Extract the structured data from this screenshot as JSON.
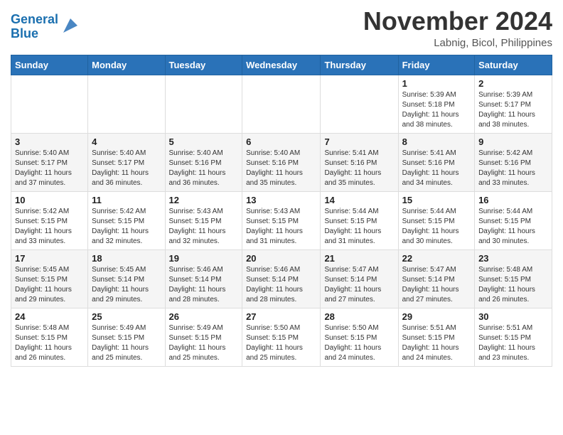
{
  "header": {
    "logo_line1": "General",
    "logo_line2": "Blue",
    "month": "November 2024",
    "location": "Labnig, Bicol, Philippines"
  },
  "weekdays": [
    "Sunday",
    "Monday",
    "Tuesday",
    "Wednesday",
    "Thursday",
    "Friday",
    "Saturday"
  ],
  "weeks": [
    [
      {
        "day": "",
        "info": ""
      },
      {
        "day": "",
        "info": ""
      },
      {
        "day": "",
        "info": ""
      },
      {
        "day": "",
        "info": ""
      },
      {
        "day": "",
        "info": ""
      },
      {
        "day": "1",
        "info": "Sunrise: 5:39 AM\nSunset: 5:18 PM\nDaylight: 11 hours\nand 38 minutes."
      },
      {
        "day": "2",
        "info": "Sunrise: 5:39 AM\nSunset: 5:17 PM\nDaylight: 11 hours\nand 38 minutes."
      }
    ],
    [
      {
        "day": "3",
        "info": "Sunrise: 5:40 AM\nSunset: 5:17 PM\nDaylight: 11 hours\nand 37 minutes."
      },
      {
        "day": "4",
        "info": "Sunrise: 5:40 AM\nSunset: 5:17 PM\nDaylight: 11 hours\nand 36 minutes."
      },
      {
        "day": "5",
        "info": "Sunrise: 5:40 AM\nSunset: 5:16 PM\nDaylight: 11 hours\nand 36 minutes."
      },
      {
        "day": "6",
        "info": "Sunrise: 5:40 AM\nSunset: 5:16 PM\nDaylight: 11 hours\nand 35 minutes."
      },
      {
        "day": "7",
        "info": "Sunrise: 5:41 AM\nSunset: 5:16 PM\nDaylight: 11 hours\nand 35 minutes."
      },
      {
        "day": "8",
        "info": "Sunrise: 5:41 AM\nSunset: 5:16 PM\nDaylight: 11 hours\nand 34 minutes."
      },
      {
        "day": "9",
        "info": "Sunrise: 5:42 AM\nSunset: 5:16 PM\nDaylight: 11 hours\nand 33 minutes."
      }
    ],
    [
      {
        "day": "10",
        "info": "Sunrise: 5:42 AM\nSunset: 5:15 PM\nDaylight: 11 hours\nand 33 minutes."
      },
      {
        "day": "11",
        "info": "Sunrise: 5:42 AM\nSunset: 5:15 PM\nDaylight: 11 hours\nand 32 minutes."
      },
      {
        "day": "12",
        "info": "Sunrise: 5:43 AM\nSunset: 5:15 PM\nDaylight: 11 hours\nand 32 minutes."
      },
      {
        "day": "13",
        "info": "Sunrise: 5:43 AM\nSunset: 5:15 PM\nDaylight: 11 hours\nand 31 minutes."
      },
      {
        "day": "14",
        "info": "Sunrise: 5:44 AM\nSunset: 5:15 PM\nDaylight: 11 hours\nand 31 minutes."
      },
      {
        "day": "15",
        "info": "Sunrise: 5:44 AM\nSunset: 5:15 PM\nDaylight: 11 hours\nand 30 minutes."
      },
      {
        "day": "16",
        "info": "Sunrise: 5:44 AM\nSunset: 5:15 PM\nDaylight: 11 hours\nand 30 minutes."
      }
    ],
    [
      {
        "day": "17",
        "info": "Sunrise: 5:45 AM\nSunset: 5:15 PM\nDaylight: 11 hours\nand 29 minutes."
      },
      {
        "day": "18",
        "info": "Sunrise: 5:45 AM\nSunset: 5:14 PM\nDaylight: 11 hours\nand 29 minutes."
      },
      {
        "day": "19",
        "info": "Sunrise: 5:46 AM\nSunset: 5:14 PM\nDaylight: 11 hours\nand 28 minutes."
      },
      {
        "day": "20",
        "info": "Sunrise: 5:46 AM\nSunset: 5:14 PM\nDaylight: 11 hours\nand 28 minutes."
      },
      {
        "day": "21",
        "info": "Sunrise: 5:47 AM\nSunset: 5:14 PM\nDaylight: 11 hours\nand 27 minutes."
      },
      {
        "day": "22",
        "info": "Sunrise: 5:47 AM\nSunset: 5:14 PM\nDaylight: 11 hours\nand 27 minutes."
      },
      {
        "day": "23",
        "info": "Sunrise: 5:48 AM\nSunset: 5:15 PM\nDaylight: 11 hours\nand 26 minutes."
      }
    ],
    [
      {
        "day": "24",
        "info": "Sunrise: 5:48 AM\nSunset: 5:15 PM\nDaylight: 11 hours\nand 26 minutes."
      },
      {
        "day": "25",
        "info": "Sunrise: 5:49 AM\nSunset: 5:15 PM\nDaylight: 11 hours\nand 25 minutes."
      },
      {
        "day": "26",
        "info": "Sunrise: 5:49 AM\nSunset: 5:15 PM\nDaylight: 11 hours\nand 25 minutes."
      },
      {
        "day": "27",
        "info": "Sunrise: 5:50 AM\nSunset: 5:15 PM\nDaylight: 11 hours\nand 25 minutes."
      },
      {
        "day": "28",
        "info": "Sunrise: 5:50 AM\nSunset: 5:15 PM\nDaylight: 11 hours\nand 24 minutes."
      },
      {
        "day": "29",
        "info": "Sunrise: 5:51 AM\nSunset: 5:15 PM\nDaylight: 11 hours\nand 24 minutes."
      },
      {
        "day": "30",
        "info": "Sunrise: 5:51 AM\nSunset: 5:15 PM\nDaylight: 11 hours\nand 23 minutes."
      }
    ]
  ]
}
